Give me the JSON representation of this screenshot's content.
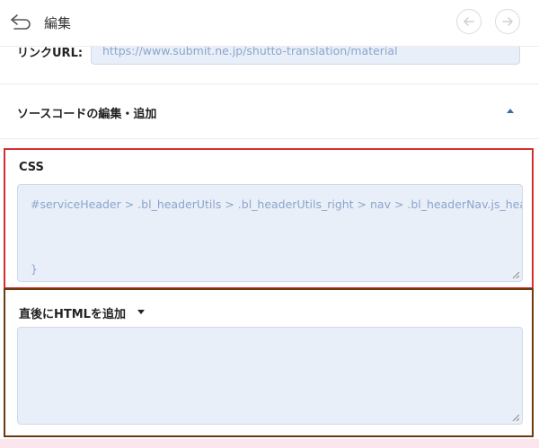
{
  "header": {
    "title": "編集",
    "back_icon": "return-arrow-icon",
    "prev_icon": "arrow-left-icon",
    "next_icon": "arrow-right-icon"
  },
  "link": {
    "label": "リンクURL:",
    "value": "https://www.submit.ne.jp/shutto-translation/material"
  },
  "source_section": {
    "title": "ソースコードの編集・追加",
    "caret_icon": "caret-up-icon"
  },
  "css_editor": {
    "label": "CSS",
    "line1": "#serviceHeader > .bl_headerUtils > .bl_headerUtils_right > nav > .bl_headerNav.js_header",
    "line2": "}"
  },
  "html_editor": {
    "label": "直後にHTMLを追加",
    "caret_icon": "caret-down-icon",
    "value": ""
  },
  "colors": {
    "css_highlight": "#d32f2f",
    "html_highlight": "#6b3a0e",
    "input_bg": "#e9eff8",
    "input_text": "#8aa5cc",
    "accent": "#3b6bb3"
  }
}
